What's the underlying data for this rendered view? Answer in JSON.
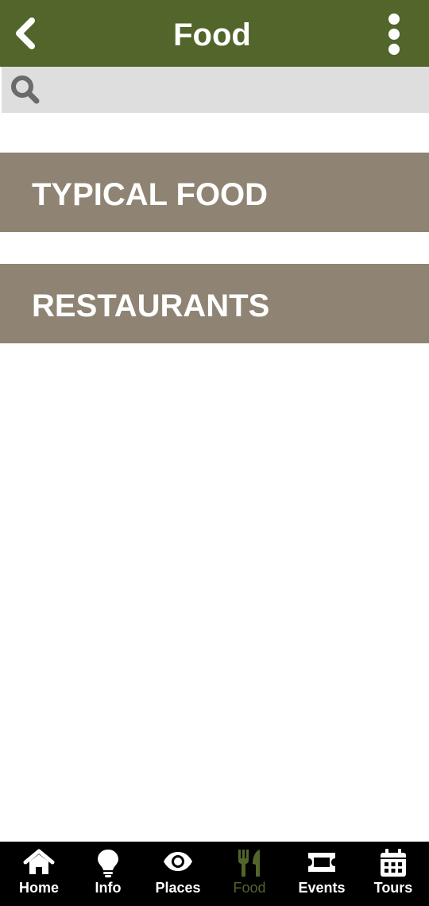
{
  "header": {
    "title": "Food",
    "back_icon": "chevron-left-icon",
    "menu_icon": "more-vertical-icon",
    "background_color": "#52652a"
  },
  "search": {
    "placeholder": "",
    "value": "",
    "icon": "search-icon"
  },
  "categories": [
    {
      "label": "TYPICAL FOOD"
    },
    {
      "label": "RESTAURANTS"
    }
  ],
  "category_color": "#8f8473",
  "tabbar": {
    "active_index": 3,
    "active_color": "#52652a",
    "items": [
      {
        "label": "Home",
        "icon": "home-icon"
      },
      {
        "label": "Info",
        "icon": "lightbulb-icon"
      },
      {
        "label": "Places",
        "icon": "eye-icon"
      },
      {
        "label": "Food",
        "icon": "utensils-icon"
      },
      {
        "label": "Events",
        "icon": "ticket-icon"
      },
      {
        "label": "Tours",
        "icon": "calendar-icon"
      }
    ]
  }
}
